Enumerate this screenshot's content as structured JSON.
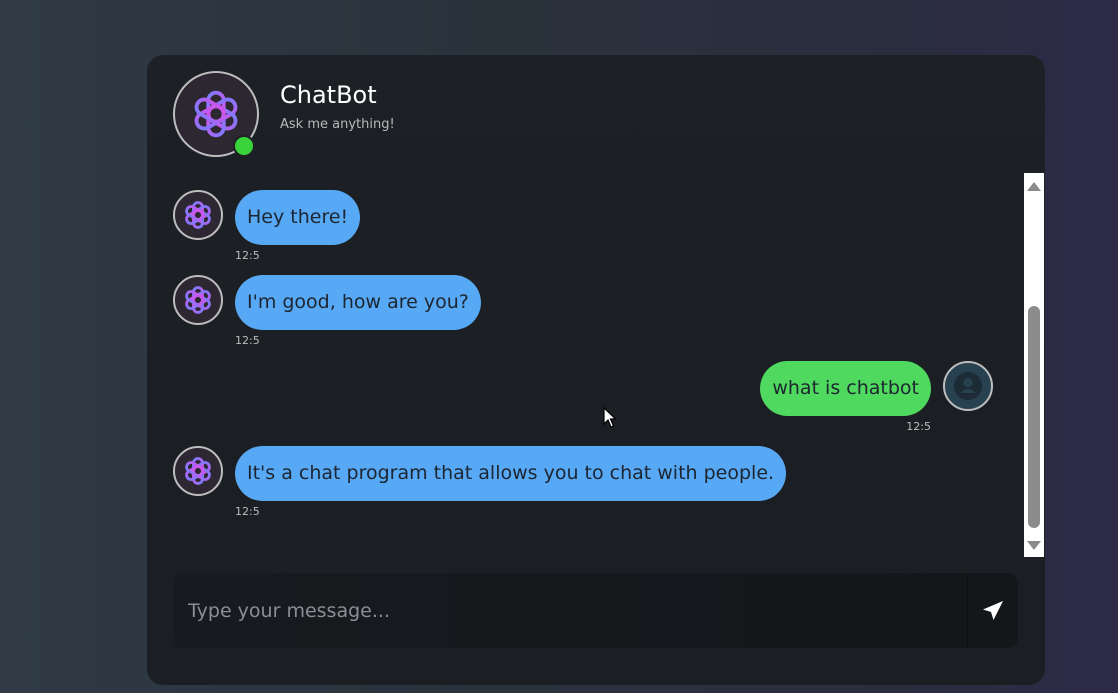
{
  "header": {
    "title": "ChatBot",
    "subtitle": "Ask me anything!",
    "status": "online"
  },
  "messages": [
    {
      "sender": "bot",
      "text": "Hey there!",
      "time": "12:5"
    },
    {
      "sender": "bot",
      "text": "I'm good, how are you?",
      "time": "12:5"
    },
    {
      "sender": "user",
      "text": "what is chatbot",
      "time": "12:5"
    },
    {
      "sender": "bot",
      "text": "It's a chat program that allows you to chat with people.",
      "time": "12:5"
    }
  ],
  "composer": {
    "placeholder": "Type your message...",
    "value": ""
  },
  "colors": {
    "bot_bubble": "#57a8f5",
    "user_bubble": "#50d95f",
    "online": "#3ad33a"
  }
}
